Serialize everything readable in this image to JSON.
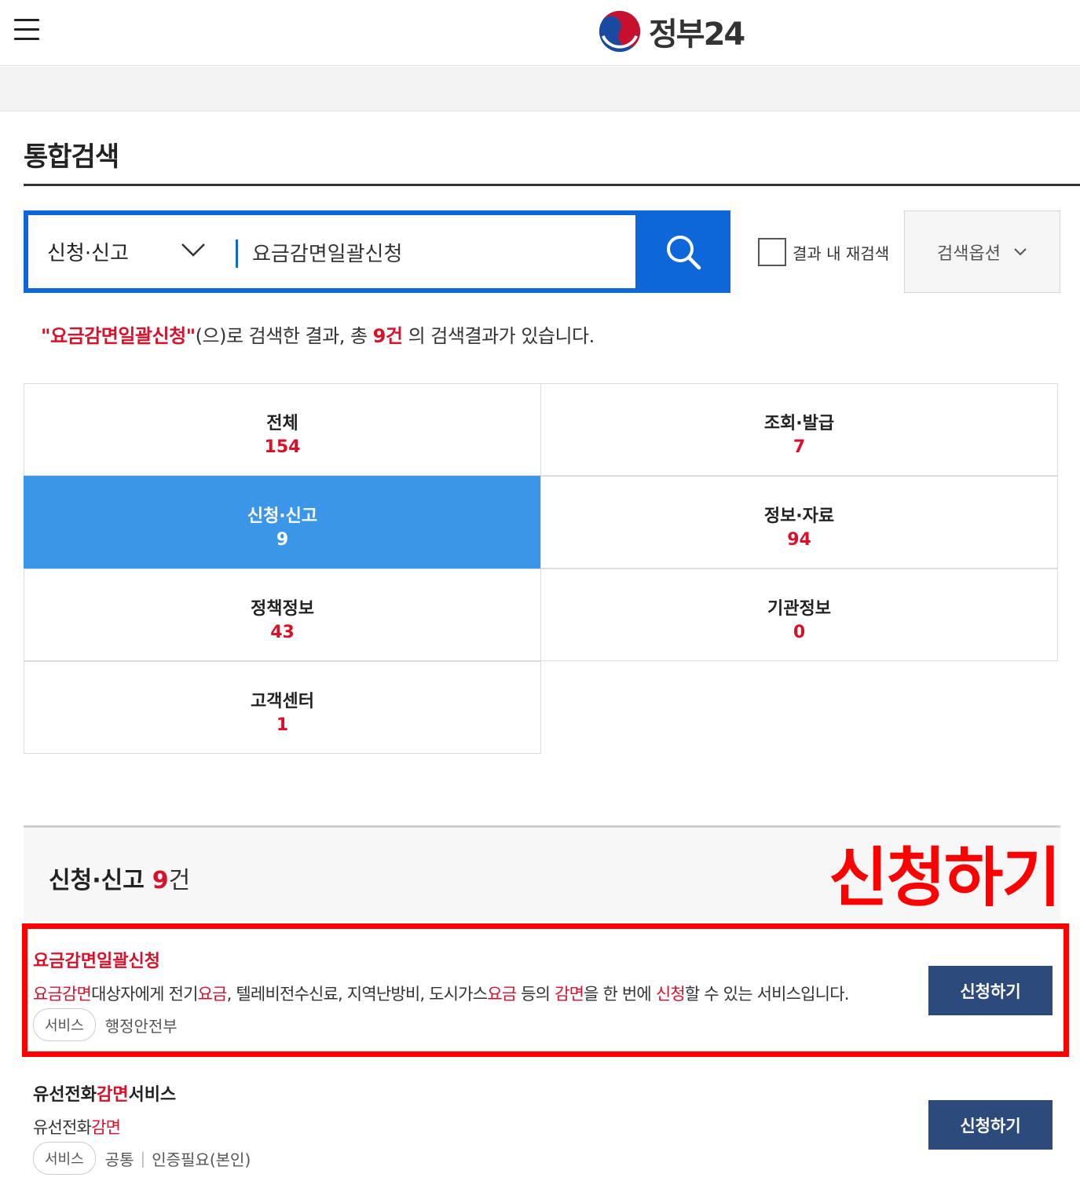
{
  "header": {
    "logo_text": "정부24",
    "logo_icon": "taegeuk-icon",
    "menu_icon": "hamburger-menu-icon"
  },
  "page": {
    "title": "통합검색"
  },
  "search": {
    "category": "신청·신고",
    "query": "요금감면일괄신청",
    "search_icon": "search-icon",
    "recheck_label": "결과 내 재검색",
    "recheck_checked": false,
    "options_label": "검색옵션"
  },
  "summary": {
    "keyword": "\"요금감면일괄신청\"",
    "text1": "(으)로 검색한 결과, 총 ",
    "count": "9건",
    "text2": " 의 검색결과가 있습니다."
  },
  "categories": [
    {
      "name": "전체",
      "count": "154",
      "active": false
    },
    {
      "name": "조회·발급",
      "count": "7",
      "active": false
    },
    {
      "name": "신청·신고",
      "count": "9",
      "active": true
    },
    {
      "name": "정보·자료",
      "count": "94",
      "active": false
    },
    {
      "name": "정책정보",
      "count": "43",
      "active": false
    },
    {
      "name": "기관정보",
      "count": "0",
      "active": false
    },
    {
      "name": "고객센터",
      "count": "1",
      "active": false
    }
  ],
  "section": {
    "title": "신청·신고",
    "count": "9",
    "unit": "건"
  },
  "annotation": {
    "label": "신청하기",
    "color": "#ff0000"
  },
  "results": [
    {
      "title": "요금감면일괄신청",
      "description_parts": [
        {
          "t": "요금감면",
          "hl": true
        },
        {
          "t": "대상자에게 전기",
          "hl": false
        },
        {
          "t": "요금",
          "hl": true
        },
        {
          "t": ", 텔레비전수신료, 지역난방비, 도시가스",
          "hl": false
        },
        {
          "t": "요금",
          "hl": true
        },
        {
          "t": " 등의 ",
          "hl": false
        },
        {
          "t": "감면",
          "hl": true
        },
        {
          "t": "을 한 번에 ",
          "hl": false
        },
        {
          "t": "신청",
          "hl": true
        },
        {
          "t": "할 수 있는 서비스입니다.",
          "hl": false
        }
      ],
      "tag": "서비스",
      "meta": [
        "행정안전부"
      ],
      "button": "신청하기"
    },
    {
      "title_parts": [
        {
          "t": "유선전화",
          "hl": false
        },
        {
          "t": "감면",
          "hl": true
        },
        {
          "t": "서비스",
          "hl": false
        }
      ],
      "description_parts": [
        {
          "t": "유선전화",
          "hl": false
        },
        {
          "t": "감면",
          "hl": true
        }
      ],
      "tag": "서비스",
      "meta": [
        "공통",
        "인증필요(본인)"
      ],
      "button": "신청하기"
    }
  ],
  "colors": {
    "primary": "#0e67d9",
    "active_tab": "#3b95e8",
    "highlight": "#d9102a",
    "button": "#2d4a7c"
  }
}
